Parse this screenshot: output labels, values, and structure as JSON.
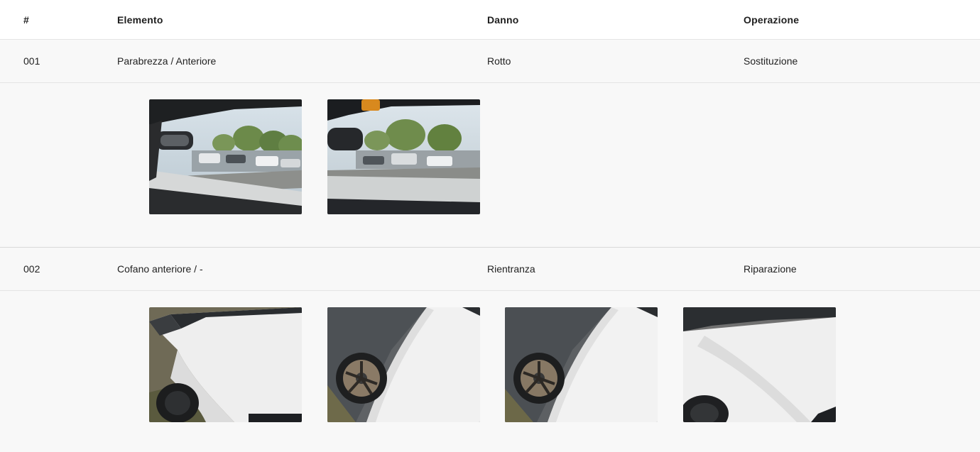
{
  "table": {
    "headers": {
      "num": "#",
      "elemento": "Elemento",
      "danno": "Danno",
      "operazione": "Operazione"
    },
    "rows": [
      {
        "num": "001",
        "elemento": "Parabrezza / Anteriore",
        "danno": "Rotto",
        "operazione": "Sostituzione",
        "photos": [
          "windshield-interior-photo",
          "windshield-interior-photo"
        ]
      },
      {
        "num": "002",
        "elemento": "Cofano anteriore / -",
        "danno": "Rientranza",
        "operazione": "Riparazione",
        "photos": [
          "white-car-hood-photo",
          "car-wheel-hood-photo",
          "car-wheel-hood-photo",
          "white-car-hood-photo"
        ]
      }
    ]
  },
  "colors": {
    "row_background": "#f8f8f8",
    "border": "#e4e4e4",
    "header_text": "#1e1e1e"
  }
}
